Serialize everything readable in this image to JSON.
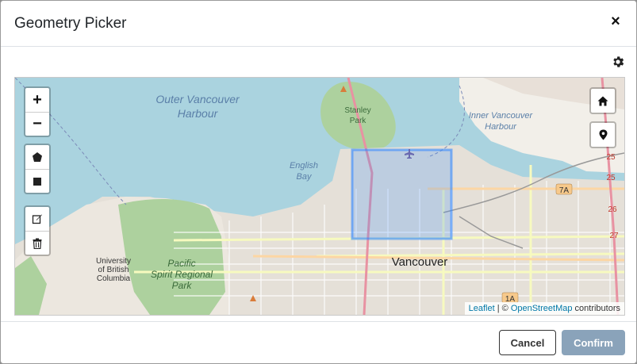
{
  "modal": {
    "title": "Geometry Picker",
    "close_symbol": "×"
  },
  "toolbar": {
    "settings_icon": "gear-icon"
  },
  "map": {
    "zoom_in_label": "+",
    "zoom_out_label": "−",
    "labels": {
      "outer_harbour_1": "Outer Vancouver",
      "outer_harbour_2": "Harbour",
      "inner_harbour_1": "Inner Vancouver",
      "inner_harbour_2": "Harbour",
      "stanley_1": "Stanley",
      "stanley_2": "Park",
      "english_bay_1": "English",
      "english_bay_2": "Bay",
      "ubc_1": "University",
      "ubc_2": "of British",
      "ubc_3": "Columbia",
      "pacific_1": "Pacific",
      "pacific_2": "Spirit Regional",
      "pacific_3": "Park",
      "vancouver": "Vancouver",
      "shield_7a": "7A",
      "shield_1a": "1A",
      "km_25a": "25",
      "km_25b": "25",
      "km_26": "26",
      "km_27": "27"
    },
    "attribution": {
      "leaflet": "Leaflet",
      "separator": " | © ",
      "osm": "OpenStreetMap",
      "suffix": " contributors"
    },
    "selection_color": "#3388ff"
  },
  "footer": {
    "cancel_label": "Cancel",
    "confirm_label": "Confirm"
  }
}
